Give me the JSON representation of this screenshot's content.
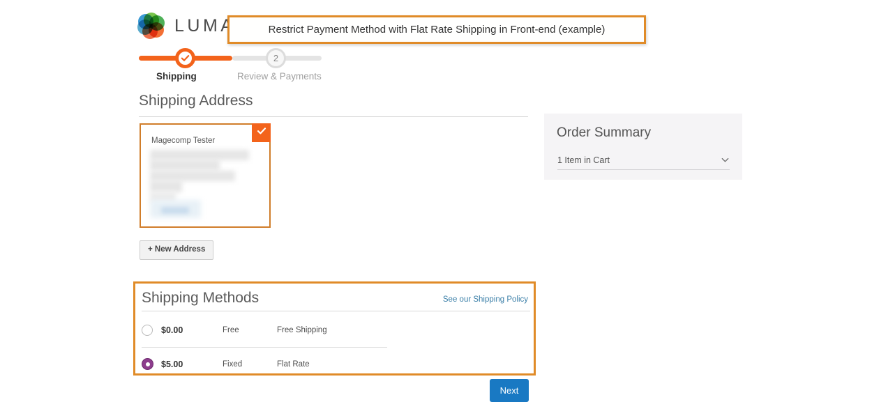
{
  "brand": {
    "name": "LUMA",
    "logo_icon": "luma-rings-logo"
  },
  "banner": {
    "text": "Restrict Payment Method with Flat Rate Shipping in Front-end (example)",
    "border_color": "#e08b28"
  },
  "progress": {
    "steps": [
      {
        "label": "Shipping",
        "number": "",
        "state": "complete",
        "icon": "check-icon"
      },
      {
        "label": "Review & Payments",
        "number": "2",
        "state": "upcoming"
      }
    ],
    "active_color": "#f3631b",
    "inactive_color": "#e4e4e4"
  },
  "shipping_address": {
    "title": "Shipping Address",
    "selected_card": {
      "name": "Magecomp Tester",
      "redacted": true,
      "badge_icon": "check-icon",
      "badge_color": "#f3631b"
    },
    "new_address_button": "+ New Address"
  },
  "order_summary": {
    "title": "Order Summary",
    "cart_row_label": "1 Item in Cart",
    "toggle_icon": "chevron-down-icon",
    "background": "#f5f4f6"
  },
  "shipping_methods": {
    "title": "Shipping Methods",
    "policy_link": "See our Shipping Policy",
    "link_color": "#3b7fa8",
    "highlight_color": "#e08b28",
    "rows": [
      {
        "price": "$0.00",
        "carrier": "Free",
        "method": "Free Shipping",
        "selected": false
      },
      {
        "price": "$5.00",
        "carrier": "Fixed",
        "method": "Flat Rate",
        "selected": true
      }
    ],
    "selected_radio_color": "#8d3c8d"
  },
  "footer": {
    "next_button": "Next",
    "next_button_color": "#1979c3"
  }
}
